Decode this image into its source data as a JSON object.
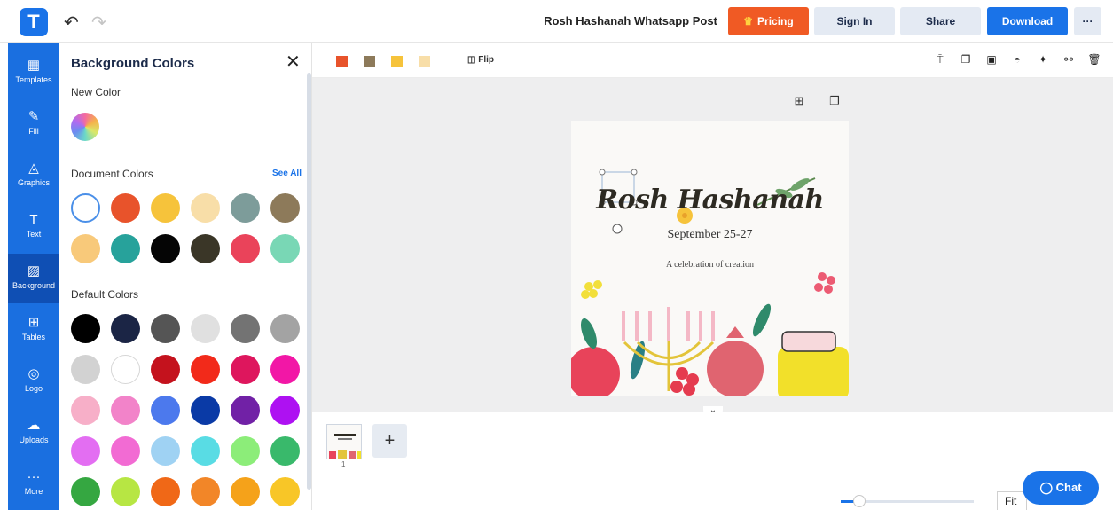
{
  "topbar": {
    "logo": "T",
    "undo_icon": "undo-icon",
    "redo_icon": "redo-icon",
    "document_title": "Rosh Hashanah Whatsapp Post",
    "pricing": "Pricing",
    "sign_in": "Sign In",
    "share": "Share",
    "download": "Download",
    "more": "···"
  },
  "nav": [
    {
      "label": "Templates",
      "icon": "templates-icon",
      "glyph": "▦"
    },
    {
      "label": "Fill",
      "icon": "fill-brush-icon",
      "glyph": "✎"
    },
    {
      "label": "Graphics",
      "icon": "graphics-shapes-icon",
      "glyph": "◬"
    },
    {
      "label": "Text",
      "icon": "text-icon",
      "glyph": "T"
    },
    {
      "label": "Background",
      "icon": "background-hatch-icon",
      "glyph": "▨"
    },
    {
      "label": "Tables",
      "icon": "tables-icon",
      "glyph": "⊞"
    },
    {
      "label": "Logo",
      "icon": "logo-icon",
      "glyph": "◎"
    },
    {
      "label": "Uploads",
      "icon": "uploads-cloud-icon",
      "glyph": "☁"
    },
    {
      "label": "More",
      "icon": "more-dots-icon",
      "glyph": "···"
    }
  ],
  "panel": {
    "title": "Background Colors",
    "close": "✕",
    "new_color_label": "New Color",
    "document_colors_label": "Document Colors",
    "see_all": "See All",
    "default_colors_label": "Default Colors",
    "document_colors": [
      "#ffffff",
      "#e8532b",
      "#f6c33b",
      "#f8dea8",
      "#7d9c9a",
      "#8d7a5a",
      "#f8c97a",
      "#27a29b",
      "#050505",
      "#3a3627",
      "#ea435a",
      "#79d7b5"
    ],
    "default_colors": [
      "#000000",
      "#1b2545",
      "#555555",
      "#e0e0e0",
      "#737373",
      "#a3a3a3",
      "#d2d2d2",
      "#ffffff",
      "#c4121d",
      "#f22a1a",
      "#de165d",
      "#f217a6",
      "#f7afc8",
      "#f283c9",
      "#4c79ed",
      "#0a3aa6",
      "#7121a6",
      "#ae11f2",
      "#e36ef2",
      "#f26bd3",
      "#9fd2f3",
      "#59dce4",
      "#8ced79",
      "#39b96b",
      "#35a741",
      "#b7e643",
      "#f06817",
      "#f28628",
      "#f5a21a",
      "#f8c627"
    ]
  },
  "canvas_toolbar": {
    "swatches": [
      "#e8532b",
      "#8d7a5a",
      "#f6c33b",
      "#f8dea8"
    ],
    "flip": "Flip",
    "icons": [
      "paint-roller-icon",
      "copy-style-icon",
      "layer-order-icon",
      "opacity-drop-icon",
      "position-icon",
      "link-icon",
      "trash-icon"
    ]
  },
  "workspace": {
    "add_page_icon": "add-page-icon",
    "duplicate_icon": "duplicate-page-icon",
    "design": {
      "title": "Rosh Hashanah",
      "date": "September 25-27",
      "subtitle": "A celebration of creation"
    }
  },
  "pages": {
    "page_number": "1",
    "add": "+",
    "fit": "Fit"
  },
  "chat": {
    "label": "Chat",
    "icon": "chat-bubble-icon"
  }
}
